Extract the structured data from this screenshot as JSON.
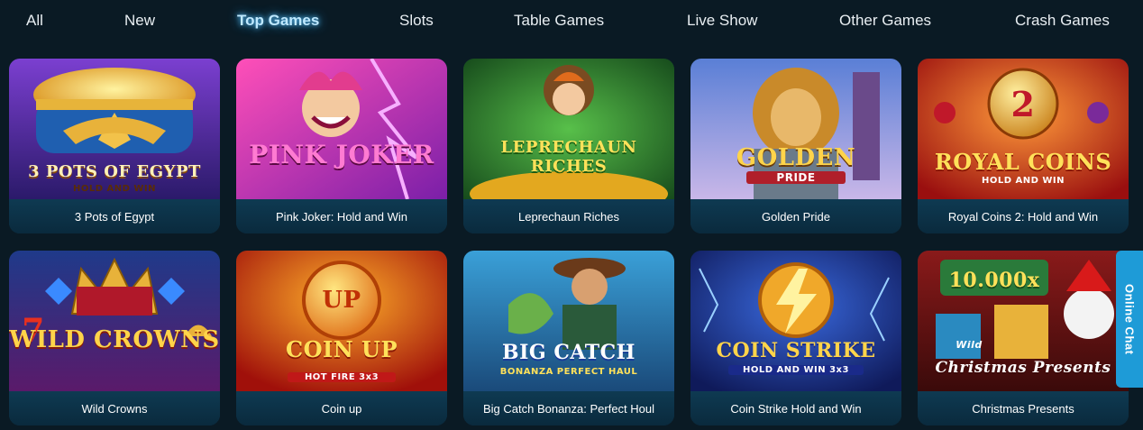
{
  "nav": {
    "items": [
      {
        "label": "All"
      },
      {
        "label": "New"
      },
      {
        "label": "Top Games"
      },
      {
        "label": "Slots"
      },
      {
        "label": "Table Games"
      },
      {
        "label": "Live Show"
      },
      {
        "label": "Other Games"
      },
      {
        "label": "Crash Games"
      }
    ],
    "active": "Top Games",
    "active_color": "#bfe9ff"
  },
  "games": [
    {
      "title": "3 Pots of Egypt",
      "logo": "3 POTS OF EGYPT",
      "sub": "HOLD AND WIN",
      "icon": "pots-of-gold-icon"
    },
    {
      "title": "Pink Joker: Hold and Win",
      "logo": "PINK JOKER",
      "sub": "",
      "icon": "joker-icon"
    },
    {
      "title": "Leprechaun Riches",
      "logo": "LEPRECHAUN RICHES",
      "sub": "",
      "icon": "leprechaun-icon"
    },
    {
      "title": "Golden Pride",
      "logo": "GOLDEN",
      "sub": "PRIDE",
      "icon": "lion-icon"
    },
    {
      "title": "Royal Coins 2: Hold and Win",
      "logo": "ROYAL COINS",
      "sub": "HOLD AND WIN",
      "badge": "2",
      "icon": "coin-icon"
    },
    {
      "title": "Wild Crowns",
      "logo": "WILD CROWNS",
      "sub": "",
      "badge": "7",
      "icon": "crown-icon"
    },
    {
      "title": "Coin up",
      "logo": "COIN UP",
      "sub": "HOT FIRE 3x3",
      "badge": "UP",
      "icon": "coin-up-icon"
    },
    {
      "title": "Big Catch Bonanza: Perfect Houl",
      "logo": "BIG CATCH",
      "sub": "BONANZA PERFECT HAUL",
      "icon": "fisherman-icon"
    },
    {
      "title": "Coin Strike Hold and Win",
      "logo": "COIN STRIKE",
      "sub": "HOLD AND WIN 3x3",
      "icon": "lightning-coin-icon"
    },
    {
      "title": "Christmas Presents",
      "logo": "Christmas Presents",
      "sub": "Wild",
      "badge": "10.000x",
      "icon": "santa-icon"
    }
  ],
  "chat": {
    "label": "Online Chat",
    "color": "#1e9bd7"
  },
  "colors": {
    "background": "#0a1a24",
    "caption": "#0e3a52"
  }
}
